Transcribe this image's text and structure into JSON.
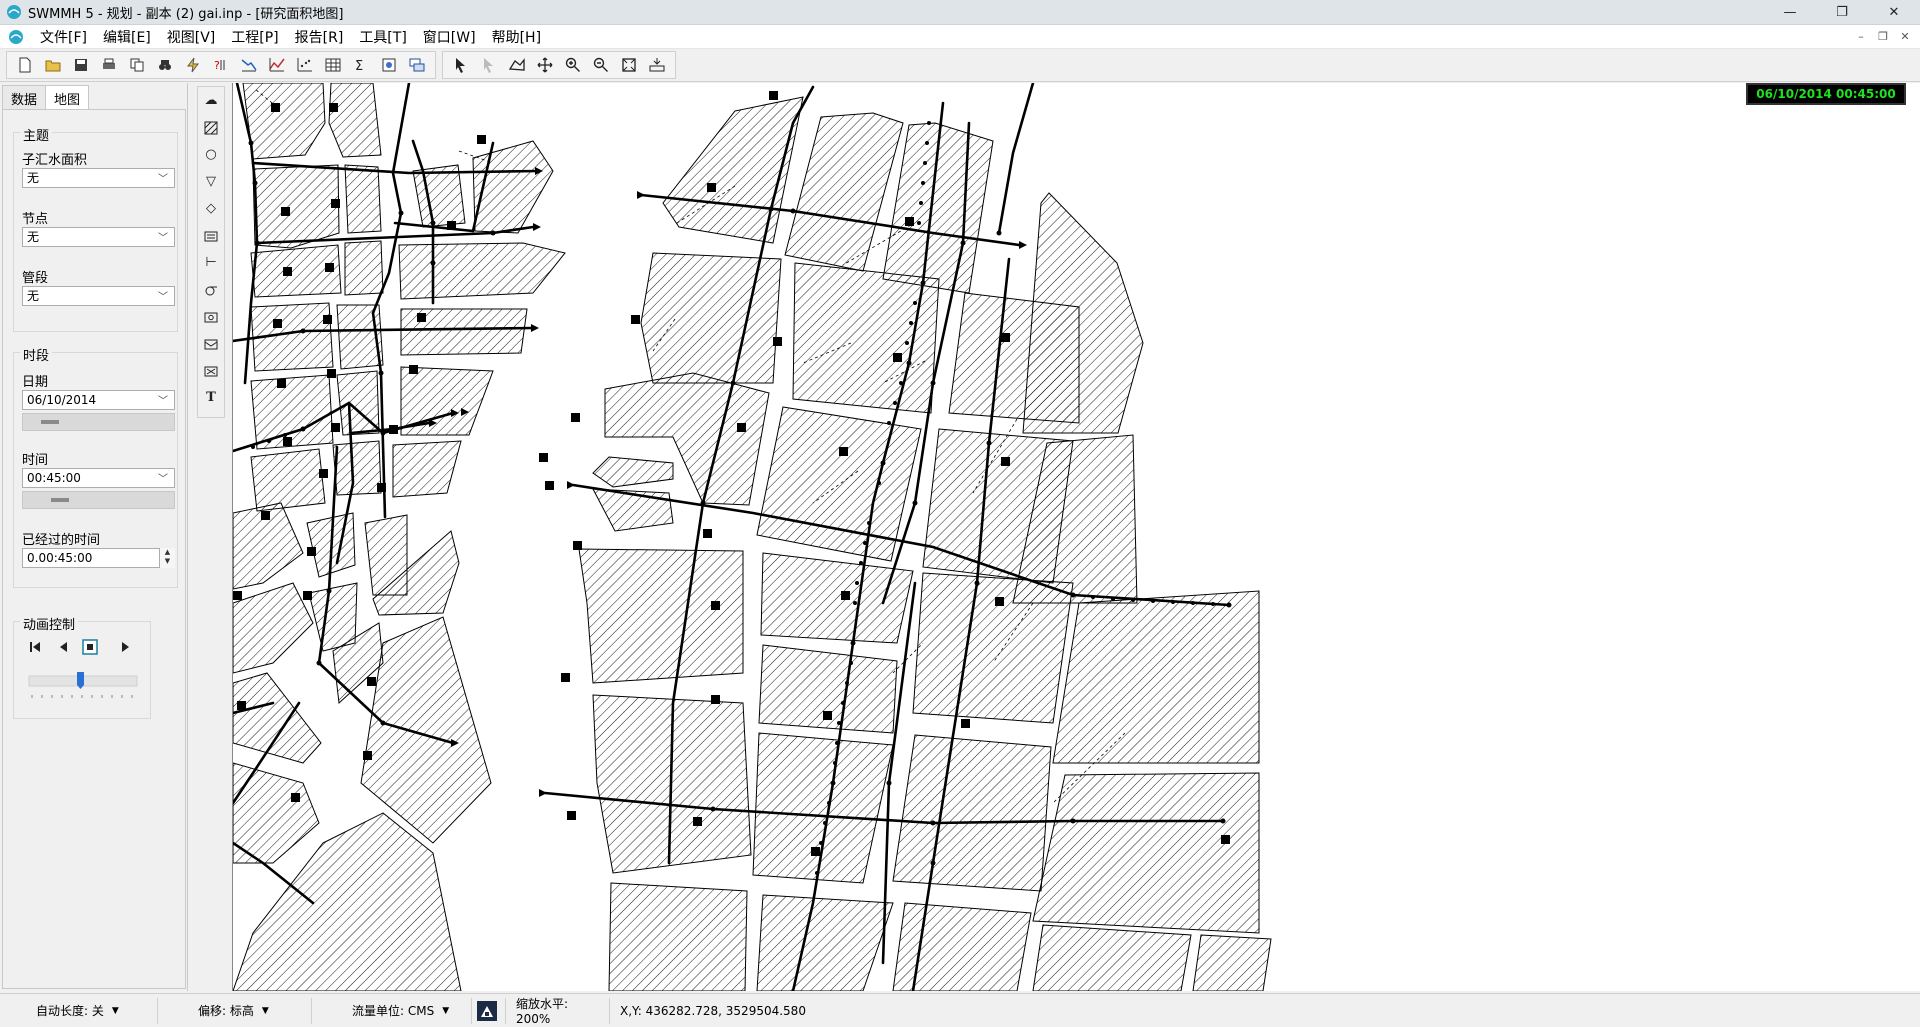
{
  "window": {
    "title": "SWMMH 5 - 规划 - 副本 (2) gai.inp - [研究面积地图]",
    "controls": [
      "—",
      "❐",
      "✕"
    ]
  },
  "menu": {
    "items": [
      "文件[F]",
      "编辑[E]",
      "视图[V]",
      "工程[P]",
      "报告[R]",
      "工具[T]",
      "窗口[W]",
      "帮助[H]"
    ],
    "mdi_controls": [
      "–",
      "❐",
      "✕"
    ]
  },
  "left_panel": {
    "tabs": [
      "数据",
      "地图"
    ],
    "active_tab": "地图",
    "theme": {
      "title": "主题",
      "subcatchment_label": "子汇水面积",
      "subcatchment_value": "无",
      "node_label": "节点",
      "node_value": "无",
      "link_label": "管段",
      "link_value": "无"
    },
    "time_period": {
      "title": "时段",
      "date_label": "日期",
      "date_value": "06/10/2014",
      "time_label": "时间",
      "time_value": "00:45:00",
      "elapsed_label": "已经过的时间",
      "elapsed_value": "0.00:45:00"
    },
    "animation": {
      "title": "动画控制"
    }
  },
  "map": {
    "clock": "06/10/2014 00:45:00"
  },
  "status_bar": {
    "auto_length": "自动长度: 关",
    "offset": "偏移: 标高",
    "flow_units": "流量单位: CMS",
    "zoom": "缩放水平: 200%",
    "coords": "X,Y: 436282.728, 3529504.580"
  }
}
